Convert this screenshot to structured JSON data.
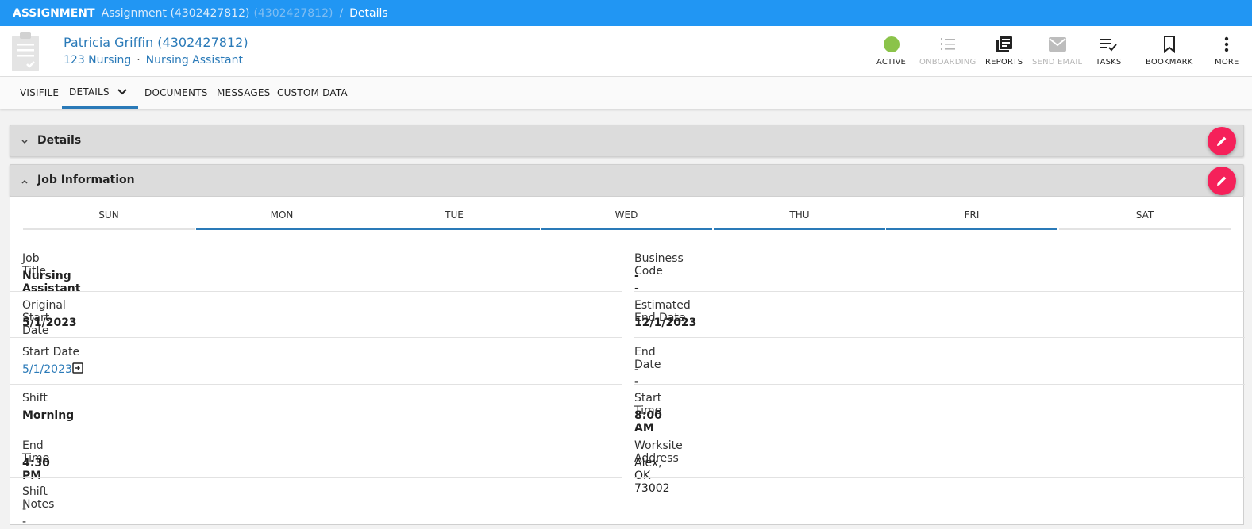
{
  "breadcrumb": {
    "root": "ASSIGNMENT",
    "assignment": "Assignment (4302427812)",
    "assignment_id_faded": "(4302427812)",
    "separator": "/",
    "current": "Details"
  },
  "header": {
    "name": "Patricia Griffin (4302427812)",
    "company": "123 Nursing",
    "dot": "·",
    "role": "Nursing Assistant"
  },
  "actions": {
    "active": "ACTIVE",
    "onboarding": "ONBOARDING",
    "reports": "REPORTS",
    "send_email": "SEND EMAIL",
    "tasks": "TASKS",
    "bookmark": "BOOKMARK",
    "more": "MORE"
  },
  "colors": {
    "topbar": "#2196f3",
    "link": "#2a7ab8",
    "status_active": "#8bc34a",
    "fab": "#f5215a"
  },
  "tabs": {
    "visifile": "VISIFILE",
    "details": "DETAILS",
    "documents": "DOCUMENTS",
    "messages": "MESSAGES",
    "custom_data": "CUSTOM DATA"
  },
  "panels": {
    "details": "Details",
    "job_information": "Job Information"
  },
  "days": [
    {
      "label": "SUN",
      "active": false
    },
    {
      "label": "MON",
      "active": true
    },
    {
      "label": "TUE",
      "active": true
    },
    {
      "label": "WED",
      "active": true
    },
    {
      "label": "THU",
      "active": true
    },
    {
      "label": "FRI",
      "active": true
    },
    {
      "label": "SAT",
      "active": false
    }
  ],
  "fields": {
    "job_title": {
      "label": "Job Title",
      "value": "Nursing Assistant"
    },
    "business_code": {
      "label": "Business Code",
      "value": "--"
    },
    "original_start_date": {
      "label": "Original Start Date",
      "value": "5/1/2023"
    },
    "estimated_end_date": {
      "label": "Estimated End Date",
      "value": "12/1/2023"
    },
    "start_date": {
      "label": "Start Date",
      "value": "5/1/2023"
    },
    "end_date": {
      "label": "End Date",
      "value": "--"
    },
    "shift": {
      "label": "Shift",
      "value": "Morning"
    },
    "start_time": {
      "label": "Start Time",
      "value": "8:00 AM"
    },
    "end_time": {
      "label": "End Time",
      "value": "4:30 PM"
    },
    "worksite_address": {
      "label": "Worksite Address",
      "value": "Alex, OK 73002"
    },
    "shift_notes": {
      "label": "Shift Notes",
      "value": "--"
    }
  }
}
